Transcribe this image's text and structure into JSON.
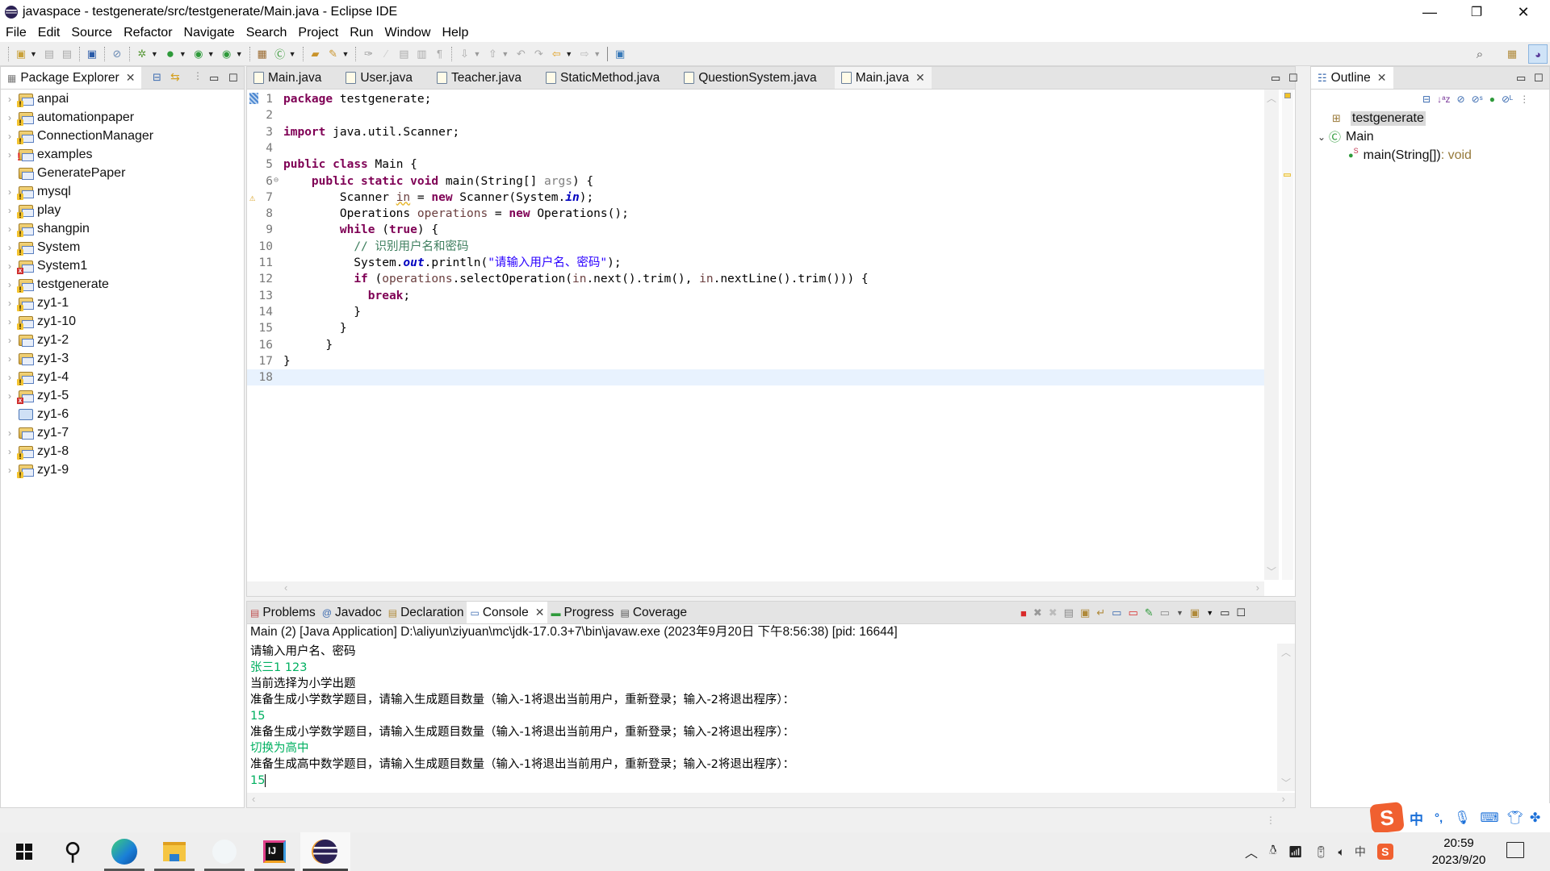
{
  "window": {
    "title": "javaspace - testgenerate/src/testgenerate/Main.java - Eclipse IDE",
    "minimize": "—",
    "restore": "❐",
    "close": "✕"
  },
  "menu": [
    "File",
    "Edit",
    "Source",
    "Refactor",
    "Navigate",
    "Search",
    "Project",
    "Run",
    "Window",
    "Help"
  ],
  "toolbar": {
    "icons": [
      "new-wizard",
      "save",
      "save-all",
      "terminal",
      "skip-breakpoints",
      "debug",
      "run",
      "run-coverage",
      "external-tools",
      "new-java-package",
      "new-java-class",
      "open-type",
      "search",
      "toggle-mark-occurrences",
      "toggle-block",
      "show-whitespace",
      "next-annotation",
      "previous-annotation",
      "last-edit-location",
      "back",
      "forward",
      "pin-editor"
    ],
    "right_icons": [
      "search-icon",
      "open-perspective",
      "java-perspective"
    ]
  },
  "package_explorer": {
    "title": "Package Explorer",
    "projects": [
      {
        "name": "anpai",
        "expandable": true,
        "status": "warning"
      },
      {
        "name": "automationpaper",
        "expandable": true,
        "status": "warning"
      },
      {
        "name": "ConnectionManager",
        "expandable": true,
        "status": "warning"
      },
      {
        "name": "examples",
        "expandable": true,
        "status": "error"
      },
      {
        "name": "GeneratePaper",
        "expandable": false,
        "status": "none"
      },
      {
        "name": "mysql",
        "expandable": true,
        "status": "warning"
      },
      {
        "name": "play",
        "expandable": true,
        "status": "warning"
      },
      {
        "name": "shangpin",
        "expandable": true,
        "status": "warning"
      },
      {
        "name": "System",
        "expandable": true,
        "status": "warning"
      },
      {
        "name": "System1",
        "expandable": true,
        "status": "error"
      },
      {
        "name": "testgenerate",
        "expandable": true,
        "status": "warning"
      },
      {
        "name": "zy1-1",
        "expandable": true,
        "status": "warning"
      },
      {
        "name": "zy1-10",
        "expandable": true,
        "status": "warning"
      },
      {
        "name": "zy1-2",
        "expandable": true,
        "status": "none"
      },
      {
        "name": "zy1-3",
        "expandable": true,
        "status": "none"
      },
      {
        "name": "zy1-4",
        "expandable": true,
        "status": "warning"
      },
      {
        "name": "zy1-5",
        "expandable": true,
        "status": "error"
      },
      {
        "name": "zy1-6",
        "expandable": false,
        "status": "closed"
      },
      {
        "name": "zy1-7",
        "expandable": true,
        "status": "none"
      },
      {
        "name": "zy1-8",
        "expandable": true,
        "status": "warning"
      },
      {
        "name": "zy1-9",
        "expandable": true,
        "status": "warning"
      }
    ]
  },
  "editor": {
    "tabs": [
      {
        "label": "Main.java",
        "active": false
      },
      {
        "label": "User.java",
        "active": false
      },
      {
        "label": "Teacher.java",
        "active": false
      },
      {
        "label": "StaticMethod.java",
        "active": false
      },
      {
        "label": "QuestionSystem.java",
        "active": false
      },
      {
        "label": "Main.java",
        "active": true
      }
    ],
    "current_line": 18,
    "lines": [
      [
        {
          "t": "package",
          "c": "kw"
        },
        {
          "t": " testgenerate;"
        }
      ],
      [],
      [
        {
          "t": "import",
          "c": "kw"
        },
        {
          "t": " java.util.Scanner;"
        }
      ],
      [],
      [
        {
          "t": "public",
          "c": "kw"
        },
        {
          "t": " "
        },
        {
          "t": "class",
          "c": "kw"
        },
        {
          "t": " Main {"
        }
      ],
      [
        {
          "t": "    "
        },
        {
          "t": "public",
          "c": "kw"
        },
        {
          "t": " "
        },
        {
          "t": "static",
          "c": "kw"
        },
        {
          "t": " "
        },
        {
          "t": "void",
          "c": "kw"
        },
        {
          "t": " main(String[] "
        },
        {
          "t": "args",
          "c": "unused"
        },
        {
          "t": ") {"
        }
      ],
      [
        {
          "t": "        Scanner "
        },
        {
          "t": "in",
          "c": "var squig"
        },
        {
          "t": " = "
        },
        {
          "t": "new",
          "c": "kw"
        },
        {
          "t": " Scanner(System."
        },
        {
          "t": "in",
          "c": "fld"
        },
        {
          "t": ");"
        }
      ],
      [
        {
          "t": "        Operations "
        },
        {
          "t": "operations",
          "c": "var"
        },
        {
          "t": " = "
        },
        {
          "t": "new",
          "c": "kw"
        },
        {
          "t": " Operations();"
        }
      ],
      [
        {
          "t": "        "
        },
        {
          "t": "while",
          "c": "kw"
        },
        {
          "t": " ("
        },
        {
          "t": "true",
          "c": "kw"
        },
        {
          "t": ") {"
        }
      ],
      [
        {
          "t": "          "
        },
        {
          "t": "// 识别用户名和密码",
          "c": "cmt"
        }
      ],
      [
        {
          "t": "          System."
        },
        {
          "t": "out",
          "c": "fld"
        },
        {
          "t": ".println("
        },
        {
          "t": "\"请输入用户名、密码\"",
          "c": "str"
        },
        {
          "t": ");"
        }
      ],
      [
        {
          "t": "          "
        },
        {
          "t": "if",
          "c": "kw"
        },
        {
          "t": " ("
        },
        {
          "t": "operations",
          "c": "var"
        },
        {
          "t": ".selectOperation("
        },
        {
          "t": "in",
          "c": "var"
        },
        {
          "t": ".next().trim(), "
        },
        {
          "t": "in",
          "c": "var"
        },
        {
          "t": ".nextLine().trim())) {"
        }
      ],
      [
        {
          "t": "            "
        },
        {
          "t": "break",
          "c": "kw"
        },
        {
          "t": ";"
        }
      ],
      [
        {
          "t": "          }"
        }
      ],
      [
        {
          "t": "        }"
        }
      ],
      [
        {
          "t": "      }"
        }
      ],
      [
        {
          "t": "}"
        }
      ],
      []
    ],
    "fold_marker_line": 6,
    "warning_marker_line": 7
  },
  "outline": {
    "title": "Outline",
    "items": [
      {
        "label": "testgenerate",
        "type": "package",
        "selected": true
      },
      {
        "label": "Main",
        "type": "class",
        "expanded": true
      },
      {
        "label": "main(String[])",
        "suffix": " : void",
        "type": "method",
        "static": true
      }
    ]
  },
  "bottom_panel": {
    "tabs": [
      {
        "label": "Problems",
        "icon": "problems-icon",
        "active": false
      },
      {
        "label": "Javadoc",
        "icon": "at-icon",
        "active": false
      },
      {
        "label": "Declaration",
        "icon": "declaration-icon",
        "active": false
      },
      {
        "label": "Console",
        "icon": "console-icon",
        "active": true
      },
      {
        "label": "Progress",
        "icon": "progress-icon",
        "active": false
      },
      {
        "label": "Coverage",
        "icon": "coverage-icon",
        "active": false
      }
    ],
    "console_description": "Main (2) [Java Application] D:\\aliyun\\ziyuan\\mc\\jdk-17.0.3+7\\bin\\javaw.exe  (2023年9月20日 下午8:56:38) [pid: 16644]",
    "output": [
      {
        "text": "请输入用户名、密码",
        "input": false
      },
      {
        "text": "张三1 123",
        "input": true
      },
      {
        "text": "当前选择为小学出题",
        "input": false
      },
      {
        "text": "准备生成小学数学题目，请输入生成题目数量（输入-1将退出当前用户，重新登录；输入-2将退出程序）：",
        "input": false
      },
      {
        "text": "15",
        "input": true
      },
      {
        "text": "准备生成小学数学题目，请输入生成题目数量（输入-1将退出当前用户，重新登录；输入-2将退出程序）：",
        "input": false
      },
      {
        "text": "切换为高中",
        "input": true
      },
      {
        "text": "准备生成高中数学题目，请输入生成题目数量（输入-1将退出当前用户，重新登录；输入-2将退出程序）：",
        "input": false
      },
      {
        "text": "15",
        "input": true
      }
    ]
  },
  "taskbar": {
    "apps": [
      "start",
      "search",
      "edge",
      "file-explorer",
      "blank-app",
      "intellij-idea",
      "eclipse"
    ],
    "tray": {
      "ime_mode": "中",
      "time": "20:59",
      "date": "2023/9/20"
    }
  },
  "ime_bar": {
    "mode": "中",
    "punct": "°,"
  },
  "colors": {
    "keyword": "#7f0055",
    "string": "#2a00ff",
    "comment": "#3f7f5f",
    "console_input": "#00b060",
    "current_line": "#e8f2fe"
  }
}
